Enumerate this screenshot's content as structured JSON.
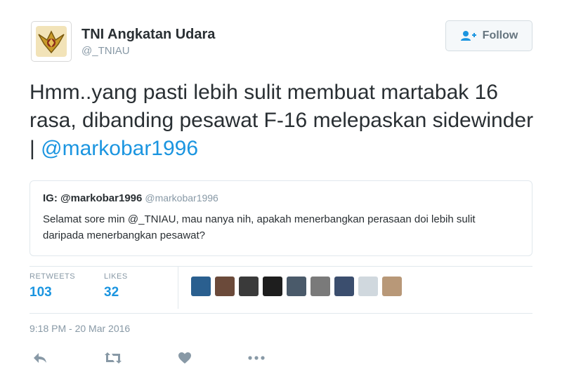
{
  "user": {
    "name": "TNI Angkatan Udara",
    "handle": "@_TNIAU"
  },
  "follow_button": {
    "label": "Follow",
    "icon": "follow-person-icon"
  },
  "tweet": {
    "text_before": "Hmm..yang pasti lebih sulit membuat martabak 16 rasa, dibanding pesawat F-16 melepaskan sidewinder | ",
    "mention": "@markobar1996"
  },
  "quoted_tweet": {
    "name": "IG: @markobar1996",
    "handle": "@markobar1996",
    "text": "Selamat sore min @_TNIAU, mau nanya nih, apakah menerbangkan perasaan doi lebih sulit daripada menerbangkan pesawat?"
  },
  "stats": {
    "retweets_label": "RETWEETS",
    "retweets_count": "103",
    "likes_label": "LIKES",
    "likes_count": "32"
  },
  "likers": [
    "#2a5f8f",
    "#6b4a3a",
    "#3a3a3a",
    "#1e1e1e",
    "#4a5a6a",
    "#7a7a7a",
    "#3b4e6e",
    "#d0d8de",
    "#b89878"
  ],
  "timestamp": "9:18 PM - 20 Mar 2016",
  "actions": [
    "reply-icon",
    "retweet-icon",
    "like-icon",
    "more-icon"
  ],
  "colors": {
    "link": "#1b95e0",
    "muted": "#8899a6",
    "text": "#292f33",
    "border": "#e1e8ed"
  }
}
